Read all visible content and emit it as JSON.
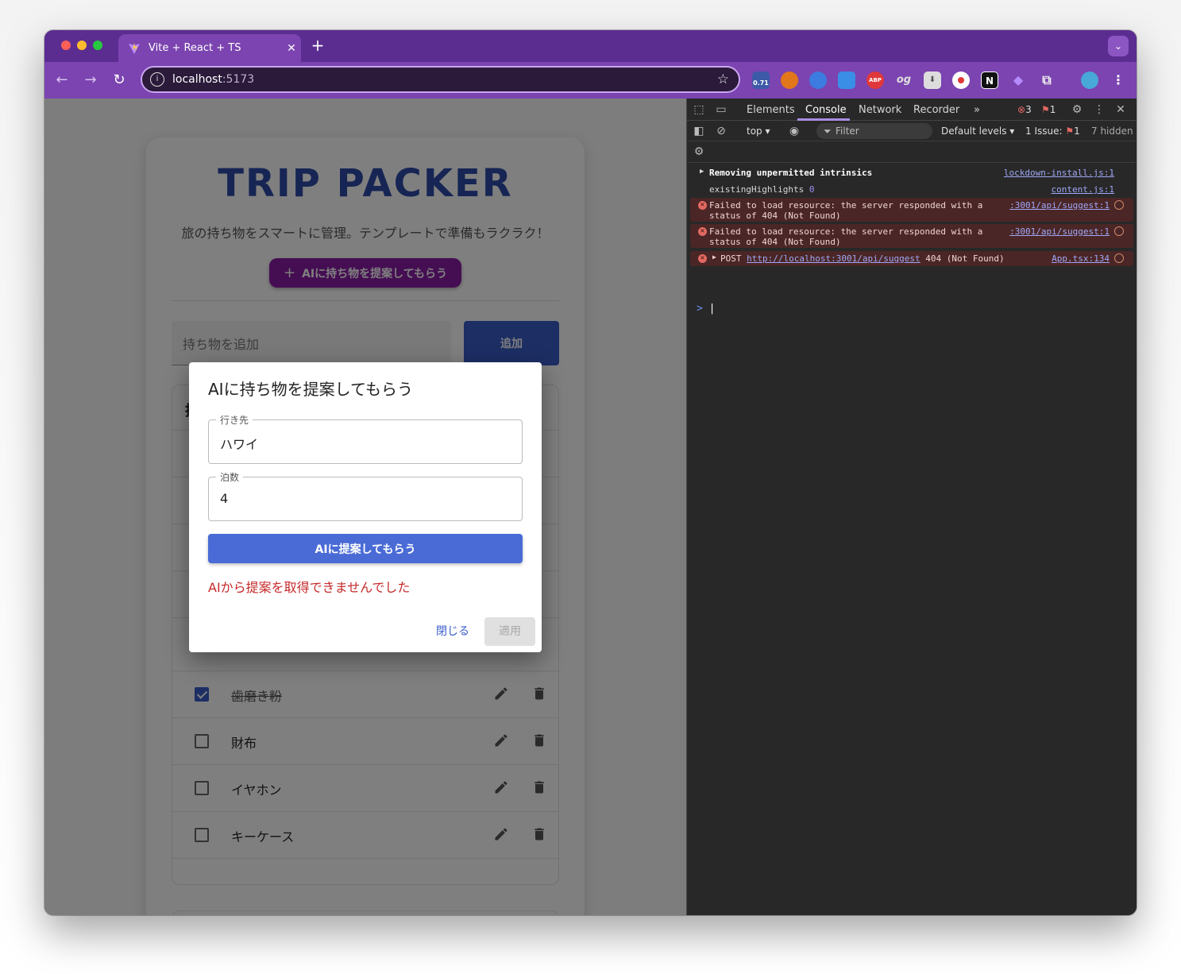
{
  "browser": {
    "tab_title": "Vite + React + TS",
    "new_tab_symbol": "+",
    "address_host": "localhost",
    "address_port": ":5173",
    "extension_badge": "0.71",
    "ext_labels": [
      "ABP",
      "og",
      "N"
    ]
  },
  "app": {
    "title": "TRIP PACKER",
    "subtitle": "旅の持ち物をスマートに管理。テンプレートで準備もラクラク！",
    "ai_button_label": "AIに持ち物を提案してもらう",
    "add_placeholder": "持ち物を追加",
    "add_button_label": "追加",
    "list_header_partial": "持",
    "items": [
      {
        "label": "歯磨き粉",
        "checked": true
      },
      {
        "label": "財布",
        "checked": false
      },
      {
        "label": "イヤホン",
        "checked": false
      },
      {
        "label": "キーケース",
        "checked": false
      }
    ]
  },
  "dialog": {
    "title": "AIに持ち物を提案してもらう",
    "destination_label": "行き先",
    "destination_value": "ハワイ",
    "nights_label": "泊数",
    "nights_value": "4",
    "suggest_button_label": "AIに提案してもらう",
    "error_message": "AIから提案を取得できませんでした",
    "close_label": "閉じる",
    "apply_label": "適用"
  },
  "devtools": {
    "tabs": [
      "Elements",
      "Console",
      "Network",
      "Recorder"
    ],
    "active_tab": "Console",
    "more_tabs": "»",
    "error_count": "3",
    "issue_count": "1",
    "context": "top",
    "filter_placeholder": "Filter",
    "levels": "Default levels",
    "issues_label": "1 Issue:",
    "issues_value": "1",
    "hidden_label": "7 hidden",
    "logs": [
      {
        "type": "group",
        "message": "Removing unpermitted intrinsics",
        "source": "lockdown-install.js:1"
      },
      {
        "type": "info",
        "message": "existingHighlights",
        "value": "0",
        "source": "content.js:1"
      },
      {
        "type": "error",
        "message_line1": "Failed to load resource: the server responded with a",
        "message_line2": "status of 404 (Not Found)",
        "source": ":3001/api/suggest:1"
      },
      {
        "type": "error",
        "message_line1": "Failed to load resource: the server responded with a",
        "message_line2": "status of 404 (Not Found)",
        "source": ":3001/api/suggest:1"
      },
      {
        "type": "error",
        "method": "POST",
        "url": "http://localhost:3001/api/suggest",
        "status": "404 (Not Found)",
        "source": "App.tsx:134"
      }
    ],
    "prompt_symbol": ">"
  },
  "colors": {
    "browser_frame": "#5c2d91",
    "title_blue": "#2c4ba8",
    "ai_purple": "#8a1ca6",
    "error_red": "#c62828",
    "primary_blue": "#4a6bd6"
  }
}
